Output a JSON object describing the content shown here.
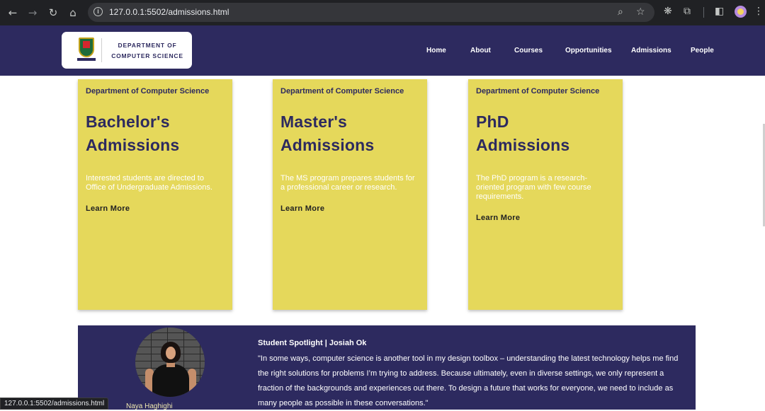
{
  "browser": {
    "url": "127.0.0.1:5502/admissions.html",
    "icons": {
      "back": "back-arrow-icon",
      "forward": "forward-arrow-icon",
      "reload": "reload-icon",
      "home": "home-icon",
      "info": "site-info-icon",
      "zoom": "zoom-icon",
      "bookmark": "star-icon",
      "extension": "extension-icon",
      "puzzle": "puzzle-icon",
      "sidepanel": "side-panel-icon",
      "menu": "kebab-menu-icon"
    },
    "status_url": "127.0.0.1:5502/admissions.html"
  },
  "header": {
    "logo_line1": "DEPARTMENT OF",
    "logo_line2": "COMPUTER SCIENCE",
    "nav": [
      "Home",
      "About",
      "Courses",
      "Opportunities",
      "Admissions",
      "People"
    ],
    "background": "#2d2a5f"
  },
  "cards": [
    {
      "eyebrow": "Department of Computer Science",
      "title_line1": "Bachelor's",
      "title_line2": "Admissions",
      "description": "Interested students are directed to Office of Undergraduate Admissions.",
      "link": "Learn More"
    },
    {
      "eyebrow": "Department of Computer Science",
      "title_line1": "Master's",
      "title_line2": "Admissions",
      "description": "The MS program prepares students for a professional career or research.",
      "link": "Learn More"
    },
    {
      "eyebrow": "Department of Computer Science",
      "title_line1": "PhD",
      "title_line2": "Admissions",
      "description": "The PhD program is a research-oriented program with few course requirements.",
      "link": "Learn More"
    }
  ],
  "card_color": "#e5d85b",
  "spotlight": {
    "title": "Student Spotlight | Josiah Ok",
    "quote": "\"In some ways, computer science is another tool in my design toolbox – understanding the latest technology helps me find the right solutions for problems I’m trying to address. Because ultimately, even in diverse settings, we only represent a fraction of the backgrounds and experiences out there. To design a future that works for everyone, we need to include as many people as possible in these conversations.\"",
    "photo_caption": "Naya Haghighi"
  }
}
